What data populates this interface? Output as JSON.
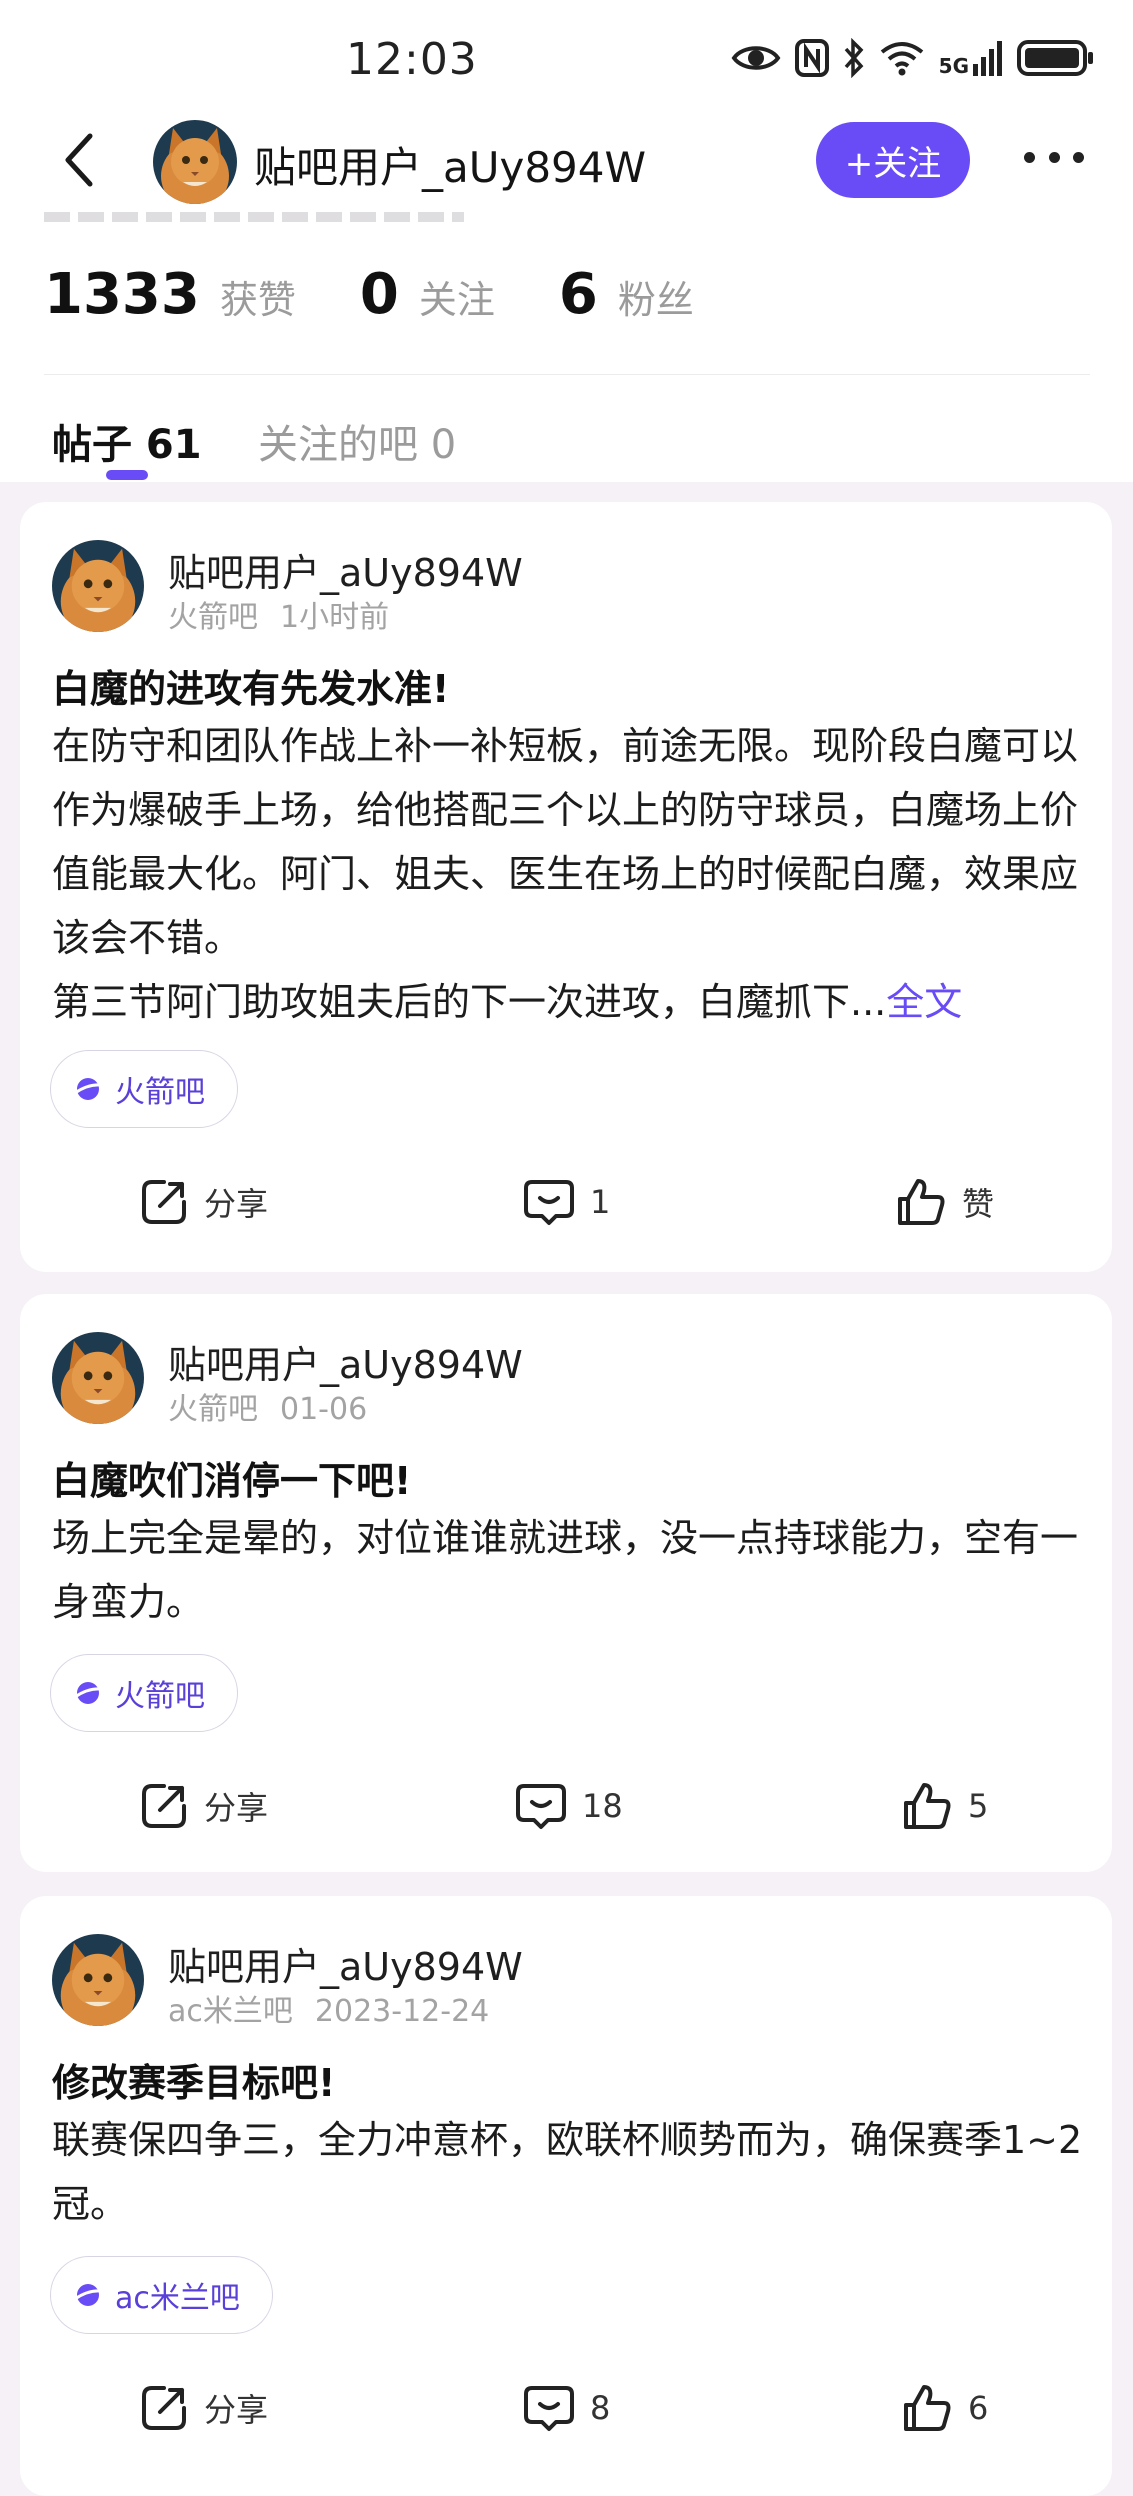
{
  "status_bar": {
    "time": "12:03",
    "network": "5G",
    "icons": [
      "eye-icon",
      "nfc-icon",
      "bluetooth-icon",
      "wifi-icon",
      "signal-icon",
      "battery-icon"
    ]
  },
  "header": {
    "username": "贴吧用户_aUy894W",
    "follow_label": "+关注"
  },
  "stats": {
    "likes_num": "1333",
    "likes_label": "获赞",
    "following_num": "0",
    "following_label": "关注",
    "fans_num": "6",
    "fans_label": "粉丝"
  },
  "tabs": [
    {
      "label": "帖子 61",
      "active": true
    },
    {
      "label": "关注的吧 0",
      "active": false
    }
  ],
  "posts": [
    {
      "author": "贴吧用户_aUy894W",
      "forum": "火箭吧",
      "time": "1小时前",
      "title": "白魔的进攻有先发水准!",
      "body": "在防守和团队作战上补一补短板，前途无限。现阶段白魔可以作为爆破手上场，给他搭配三个以上的防守球员，白魔场上价值能最大化。阿门、姐夫、医生在场上的时候配白魔，效果应该会不错。",
      "body2": "第三节阿门助攻姐夫后的下一次进攻，白魔抓下...",
      "more_label": "全文",
      "tag": "火箭吧",
      "share_label": "分享",
      "comments": "1",
      "likes": "赞"
    },
    {
      "author": "贴吧用户_aUy894W",
      "forum": "火箭吧",
      "time": "01-06",
      "title": "白魔吹们消停一下吧!",
      "body": "场上完全是晕的，对位谁谁就进球，没一点持球能力，空有一身蛮力。",
      "tag": "火箭吧",
      "share_label": "分享",
      "comments": "18",
      "likes": "5"
    },
    {
      "author": "贴吧用户_aUy894W",
      "forum": "ac米兰吧",
      "time": "2023-12-24",
      "title": "修改赛季目标吧!",
      "body": "联赛保四争三，全力冲意杯，欧联杯顺势而为，确保赛季1~2冠。",
      "tag": "ac米兰吧",
      "share_label": "分享",
      "comments": "8",
      "likes": "6"
    }
  ],
  "colors": {
    "accent": "#6a4cf6",
    "page_bg": "#f5f1f6",
    "muted": "#9b9b9b"
  }
}
